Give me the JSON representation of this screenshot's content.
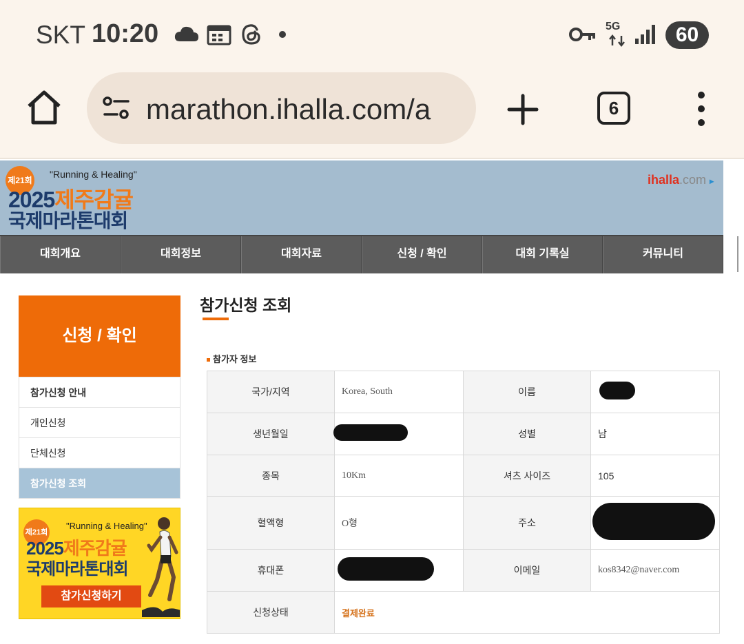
{
  "status_bar": {
    "carrier": "SKT",
    "time": "10:20",
    "network": "5G",
    "battery": "60",
    "icons": [
      "cloud-icon",
      "calendar-icon",
      "threads-icon",
      "dot-icon",
      "key-icon",
      "signal-icon"
    ]
  },
  "browser": {
    "url": "marathon.ihalla.com/a",
    "tab_count": "6"
  },
  "site": {
    "logo_edition": "제21회",
    "logo_slogan": "\"Running & Healing\"",
    "logo_year": "2025",
    "logo_title_orange": "제주감귤",
    "logo_title_line2": "국제마라톤대회",
    "partner": "ihalla",
    "partner_suffix": ".com",
    "partner_arrow": "▸"
  },
  "nav": {
    "items": [
      "대회개요",
      "대회정보",
      "대회자료",
      "신청 / 확인",
      "대회 기록실",
      "커뮤니티"
    ]
  },
  "sidebar": {
    "heading": "신청 / 확인",
    "items": [
      "참가신청 안내",
      "개인신청",
      "단체신청",
      "참가신청 조회"
    ],
    "active_index": 3,
    "promo": {
      "edition": "제21회",
      "slogan": "\"Running & Healing\"",
      "year": "2025",
      "title_orange": "제주감귤",
      "title_line2": "국제마라톤대회",
      "button": "참가신청하기"
    }
  },
  "content": {
    "title": "참가신청 조회",
    "section": "참가자 정보",
    "fields": {
      "country_label": "국가/지역",
      "country_value": "Korea, South",
      "name_label": "이름",
      "birth_label": "생년월일",
      "gender_label": "성별",
      "gender_value": "남",
      "event_label": "종목",
      "event_value": "10Km",
      "shirt_label": "셔츠 사이즈",
      "shirt_value": "105",
      "blood_label": "혈액형",
      "blood_value": "O형",
      "address_label": "주소",
      "phone_label": "휴대폰",
      "email_label": "이메일",
      "email_value": "kos8342@naver.com",
      "status_label": "신청상태",
      "status_value": "결제완료"
    }
  },
  "colors": {
    "accent_orange": "#ee6b08",
    "header_blue": "#a4bccf",
    "nav_gray": "#5c5c5c",
    "status_orange": "#d5711a"
  }
}
